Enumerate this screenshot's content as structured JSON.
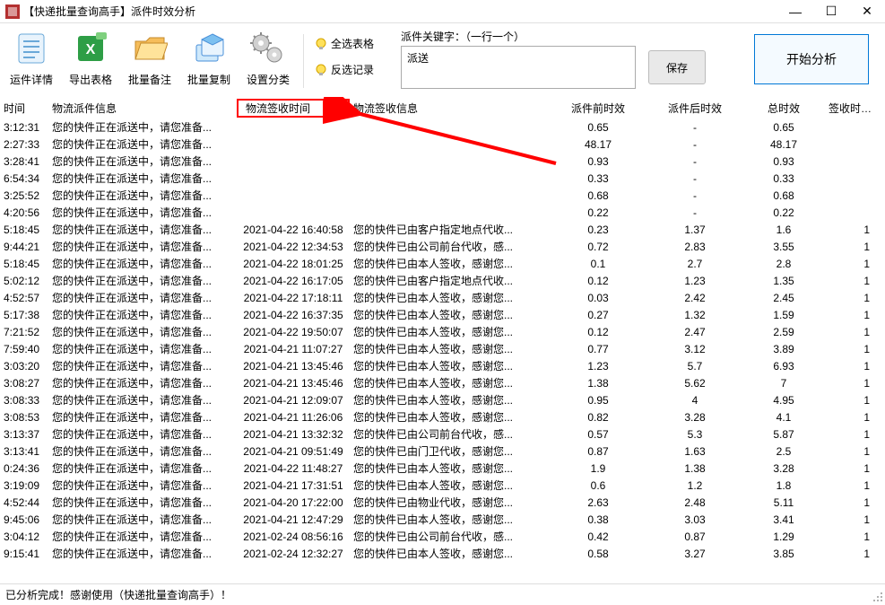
{
  "window": {
    "title": "【快递批量查询高手】派件时效分析",
    "min": "—",
    "max": "☐",
    "close": "✕"
  },
  "toolbar": {
    "items": [
      {
        "label": "运件详情"
      },
      {
        "label": "导出表格"
      },
      {
        "label": "批量备注"
      },
      {
        "label": "批量复制"
      },
      {
        "label": "设置分类"
      }
    ],
    "small": [
      {
        "label": "全选表格"
      },
      {
        "label": "反选记录"
      }
    ]
  },
  "keyword": {
    "label": "派件关键字：（一行一个）",
    "value": "派送",
    "save": "保存"
  },
  "analyze": {
    "label": "开始分析"
  },
  "table": {
    "headers": {
      "time": "时间",
      "info": "物流派件信息",
      "stime": "物流签收时间",
      "sinfo": "物流签收信息",
      "pre": "派件前时效",
      "post": "派件后时效",
      "total": "总时效",
      "days": "签收时效(天)"
    },
    "rows": [
      {
        "t": "3:12:31",
        "info": "您的快件正在派送中，请您准备...",
        "st": "",
        "si": "",
        "pre": "0.65",
        "post": "-",
        "tot": "0.65",
        "d": ""
      },
      {
        "t": "2:27:33",
        "info": "您的快件正在派送中，请您准备...",
        "st": "",
        "si": "",
        "pre": "48.17",
        "post": "-",
        "tot": "48.17",
        "d": ""
      },
      {
        "t": "3:28:41",
        "info": "您的快件正在派送中，请您准备...",
        "st": "",
        "si": "",
        "pre": "0.93",
        "post": "-",
        "tot": "0.93",
        "d": ""
      },
      {
        "t": "6:54:34",
        "info": "您的快件正在派送中，请您准备...",
        "st": "",
        "si": "",
        "pre": "0.33",
        "post": "-",
        "tot": "0.33",
        "d": ""
      },
      {
        "t": "3:25:52",
        "info": "您的快件正在派送中，请您准备...",
        "st": "",
        "si": "",
        "pre": "0.68",
        "post": "-",
        "tot": "0.68",
        "d": ""
      },
      {
        "t": "4:20:56",
        "info": "您的快件正在派送中，请您准备...",
        "st": "",
        "si": "",
        "pre": "0.22",
        "post": "-",
        "tot": "0.22",
        "d": ""
      },
      {
        "t": "5:18:45",
        "info": "您的快件正在派送中，请您准备...",
        "st": "2021-04-22 16:40:58",
        "si": "您的快件已由客户指定地点代收...",
        "pre": "0.23",
        "post": "1.37",
        "tot": "1.6",
        "d": "1"
      },
      {
        "t": "9:44:21",
        "info": "您的快件正在派送中，请您准备...",
        "st": "2021-04-22 12:34:53",
        "si": "您的快件已由公司前台代收，感...",
        "pre": "0.72",
        "post": "2.83",
        "tot": "3.55",
        "d": "1"
      },
      {
        "t": "5:18:45",
        "info": "您的快件正在派送中，请您准备...",
        "st": "2021-04-22 18:01:25",
        "si": "您的快件已由本人签收，感谢您...",
        "pre": "0.1",
        "post": "2.7",
        "tot": "2.8",
        "d": "1"
      },
      {
        "t": "5:02:12",
        "info": "您的快件正在派送中，请您准备...",
        "st": "2021-04-22 16:17:05",
        "si": "您的快件已由客户指定地点代收...",
        "pre": "0.12",
        "post": "1.23",
        "tot": "1.35",
        "d": "1"
      },
      {
        "t": "4:52:57",
        "info": "您的快件正在派送中，请您准备...",
        "st": "2021-04-22 17:18:11",
        "si": "您的快件已由本人签收，感谢您...",
        "pre": "0.03",
        "post": "2.42",
        "tot": "2.45",
        "d": "1"
      },
      {
        "t": "5:17:38",
        "info": "您的快件正在派送中，请您准备...",
        "st": "2021-04-22 16:37:35",
        "si": "您的快件已由本人签收，感谢您...",
        "pre": "0.27",
        "post": "1.32",
        "tot": "1.59",
        "d": "1"
      },
      {
        "t": "7:21:52",
        "info": "您的快件正在派送中，请您准备...",
        "st": "2021-04-22 19:50:07",
        "si": "您的快件已由本人签收，感谢您...",
        "pre": "0.12",
        "post": "2.47",
        "tot": "2.59",
        "d": "1"
      },
      {
        "t": "7:59:40",
        "info": "您的快件正在派送中，请您准备...",
        "st": "2021-04-21 11:07:27",
        "si": "您的快件已由本人签收，感谢您...",
        "pre": "0.77",
        "post": "3.12",
        "tot": "3.89",
        "d": "1"
      },
      {
        "t": "3:03:20",
        "info": "您的快件正在派送中，请您准备...",
        "st": "2021-04-21 13:45:46",
        "si": "您的快件已由本人签收，感谢您...",
        "pre": "1.23",
        "post": "5.7",
        "tot": "6.93",
        "d": "1"
      },
      {
        "t": "3:08:27",
        "info": "您的快件正在派送中，请您准备...",
        "st": "2021-04-21 13:45:46",
        "si": "您的快件已由本人签收，感谢您...",
        "pre": "1.38",
        "post": "5.62",
        "tot": "7",
        "d": "1"
      },
      {
        "t": "3:08:33",
        "info": "您的快件正在派送中，请您准备...",
        "st": "2021-04-21 12:09:07",
        "si": "您的快件已由本人签收，感谢您...",
        "pre": "0.95",
        "post": "4",
        "tot": "4.95",
        "d": "1"
      },
      {
        "t": "3:08:53",
        "info": "您的快件正在派送中，请您准备...",
        "st": "2021-04-21 11:26:06",
        "si": "您的快件已由本人签收，感谢您...",
        "pre": "0.82",
        "post": "3.28",
        "tot": "4.1",
        "d": "1"
      },
      {
        "t": "3:13:37",
        "info": "您的快件正在派送中，请您准备...",
        "st": "2021-04-21 13:32:32",
        "si": "您的快件已由公司前台代收，感...",
        "pre": "0.57",
        "post": "5.3",
        "tot": "5.87",
        "d": "1"
      },
      {
        "t": "3:13:41",
        "info": "您的快件正在派送中，请您准备...",
        "st": "2021-04-21 09:51:49",
        "si": "您的快件已由门卫代收，感谢您...",
        "pre": "0.87",
        "post": "1.63",
        "tot": "2.5",
        "d": "1"
      },
      {
        "t": "0:24:36",
        "info": "您的快件正在派送中，请您准备...",
        "st": "2021-04-22 11:48:27",
        "si": "您的快件已由本人签收，感谢您...",
        "pre": "1.9",
        "post": "1.38",
        "tot": "3.28",
        "d": "1"
      },
      {
        "t": "3:19:09",
        "info": "您的快件正在派送中，请您准备...",
        "st": "2021-04-21 17:31:51",
        "si": "您的快件已由本人签收，感谢您...",
        "pre": "0.6",
        "post": "1.2",
        "tot": "1.8",
        "d": "1"
      },
      {
        "t": "4:52:44",
        "info": "您的快件正在派送中，请您准备...",
        "st": "2021-04-20 17:22:00",
        "si": "您的快件已由物业代收，感谢您...",
        "pre": "2.63",
        "post": "2.48",
        "tot": "5.11",
        "d": "1"
      },
      {
        "t": "9:45:06",
        "info": "您的快件正在派送中，请您准备...",
        "st": "2021-04-21 12:47:29",
        "si": "您的快件已由本人签收，感谢您...",
        "pre": "0.38",
        "post": "3.03",
        "tot": "3.41",
        "d": "1"
      },
      {
        "t": "3:04:12",
        "info": "您的快件正在派送中，请您准备...",
        "st": "2021-02-24 08:56:16",
        "si": "您的快件已由公司前台代收，感...",
        "pre": "0.42",
        "post": "0.87",
        "tot": "1.29",
        "d": "1"
      },
      {
        "t": "9:15:41",
        "info": "您的快件正在派送中，请您准备...",
        "st": "2021-02-24 12:32:27",
        "si": "您的快件已由本人签收，感谢您...",
        "pre": "0.58",
        "post": "3.27",
        "tot": "3.85",
        "d": "1"
      }
    ]
  },
  "status": {
    "text": "已分析完成！感谢使用（快递批量查询高手）！"
  }
}
